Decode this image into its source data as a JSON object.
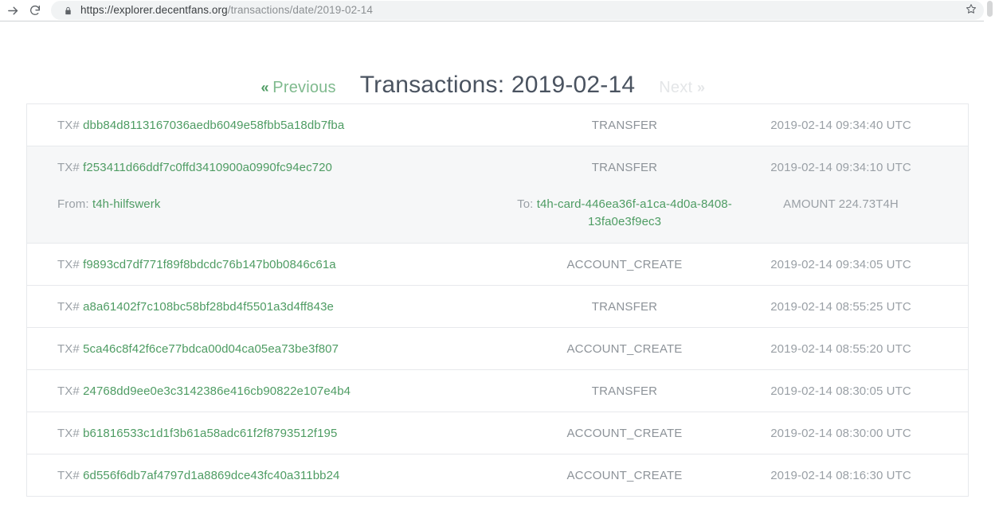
{
  "browser": {
    "forward_icon": "forward-arrow-icon",
    "reload_icon": "reload-icon",
    "lock_icon": "lock-icon",
    "star_icon": "bookmark-star-icon",
    "url_domain": "https://explorer.decentfans.org",
    "url_path": "/transactions/date/2019-02-14",
    "url_full": "https://explorer.decentfans.org/transactions/date/2019-02-14"
  },
  "header": {
    "prev_chevrons": "«",
    "prev_label": "Previous",
    "title": "Transactions: 2019-02-14",
    "next_label": "Next",
    "next_chevrons": "»"
  },
  "colors": {
    "link_green": "#4e9c63",
    "muted_gray": "#9aa0a6",
    "title_slate": "#4a5360",
    "row_alt_bg": "#f6f7f8",
    "border": "#e7e9ec",
    "disabled": "#e4e6e8"
  },
  "labels": {
    "tx_prefix": "TX#",
    "from_prefix": "From:",
    "to_prefix": "To:",
    "amount_prefix": "AMOUNT"
  },
  "transactions": [
    {
      "hash": "dbb84d8113167036aedb6049e58fbb5a18db7fba",
      "type": "TRANSFER",
      "time": "2019-02-14 09:34:40 UTC",
      "highlighted": false,
      "has_detail": false
    },
    {
      "hash": "f253411d66ddf7c0ffd3410900a0990fc94ec720",
      "type": "TRANSFER",
      "time": "2019-02-14 09:34:10 UTC",
      "highlighted": true,
      "has_detail": true,
      "from": "t4h-hilfswerk",
      "to": "t4h-card-446ea36f-a1ca-4d0a-8408-13fa0e3f9ec3",
      "amount": "224.73T4H"
    },
    {
      "hash": "f9893cd7df771f89f8bdcdc76b147b0b0846c61a",
      "type": "ACCOUNT_CREATE",
      "time": "2019-02-14 09:34:05 UTC",
      "highlighted": false,
      "has_detail": false
    },
    {
      "hash": "a8a61402f7c108bc58bf28bd4f5501a3d4ff843e",
      "type": "TRANSFER",
      "time": "2019-02-14 08:55:25 UTC",
      "highlighted": false,
      "has_detail": false
    },
    {
      "hash": "5ca46c8f42f6ce77bdca00d04ca05ea73be3f807",
      "type": "ACCOUNT_CREATE",
      "time": "2019-02-14 08:55:20 UTC",
      "highlighted": false,
      "has_detail": false
    },
    {
      "hash": "24768dd9ee0e3c3142386e416cb90822e107e4b4",
      "type": "TRANSFER",
      "time": "2019-02-14 08:30:05 UTC",
      "highlighted": false,
      "has_detail": false
    },
    {
      "hash": "b61816533c1d1f3b61a58adc61f2f8793512f195",
      "type": "ACCOUNT_CREATE",
      "time": "2019-02-14 08:30:00 UTC",
      "highlighted": false,
      "has_detail": false
    },
    {
      "hash": "6d556f6db7af4797d1a8869dce43fc40a311bb24",
      "type": "ACCOUNT_CREATE",
      "time": "2019-02-14 08:16:30 UTC",
      "highlighted": false,
      "has_detail": false
    }
  ]
}
